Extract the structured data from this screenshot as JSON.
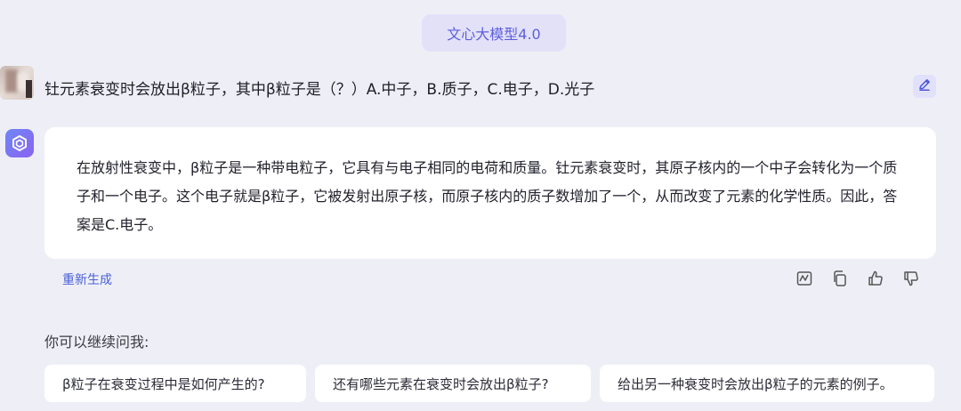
{
  "header": {
    "model_label": "文心大模型4.0"
  },
  "conversation": {
    "question": "钍元素衰变时会放出β粒子，其中β粒子是（？）A.中子，B.质子，C.电子，D.光子",
    "answer": "在放射性衰变中，β粒子是一种带电粒子，它具有与电子相同的电荷和质量。钍元素衰变时，其原子核内的一个中子会转化为一个质子和一个电子。这个电子就是β粒子，它被发射出原子核，而原子核内的质子数增加了一个，从而改变了元素的化学性质。因此，答案是C.电子。"
  },
  "actions": {
    "regenerate_label": "重新生成",
    "icons": [
      "report-icon",
      "copy-icon",
      "thumbs-up-icon",
      "thumbs-down-icon"
    ]
  },
  "followup": {
    "prompt": "你可以继续问我:",
    "suggestions": [
      "β粒子在衰变过程中是如何产生的?",
      "还有哪些元素在衰变时会放出β粒子?",
      "给出另一种衰变时会放出β粒子的元素的例子。"
    ]
  },
  "colors": {
    "background": "#eeeff6",
    "accent": "#5d5fdc",
    "link": "#4b5fd6",
    "card": "#ffffff"
  }
}
